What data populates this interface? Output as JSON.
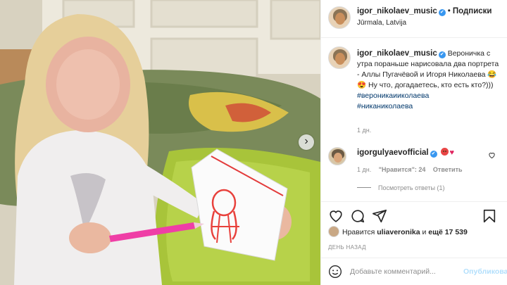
{
  "post": {
    "next_label": "›"
  },
  "header": {
    "username": "igor_nikolaev_music",
    "verified_mark": "✔",
    "separator": "•",
    "follow_label": "Подписки",
    "location": "Jūrmala, Latvija"
  },
  "caption": {
    "username": "igor_nikolaev_music",
    "text": "Вероничка с утра пораньше нарисовала два портрета - Аллы Пугачёвой и Игоря Николаева 😂😍 Ну что, догадаетесь, кто есть кто?)))",
    "hashtags": [
      "#вероникаииколаева",
      "#никаниколаева"
    ],
    "time": "1 дн."
  },
  "comment": {
    "username": "igorgulyaevofficial",
    "time": "1 дн.",
    "likes_label": "\"Нравится\": 24",
    "reply_label": "Ответить",
    "view_replies": "Посмотреть ответы (1)"
  },
  "likes": {
    "prefix": "Нравится",
    "user": "uliaveronika",
    "and": "и",
    "count": "ещё 17 539"
  },
  "date": "ДЕНЬ НАЗАД",
  "add_comment": {
    "placeholder": "Добавьте комментарий...",
    "publish_label": "Опубликовать"
  },
  "icons": [
    "heart-icon",
    "comment-icon",
    "share-icon",
    "bookmark-icon",
    "smile-icon"
  ],
  "colors": {
    "link": "#00376b",
    "verified": "#3897f0",
    "publish": "#b2dffc",
    "muted": "#8e8e8e"
  }
}
